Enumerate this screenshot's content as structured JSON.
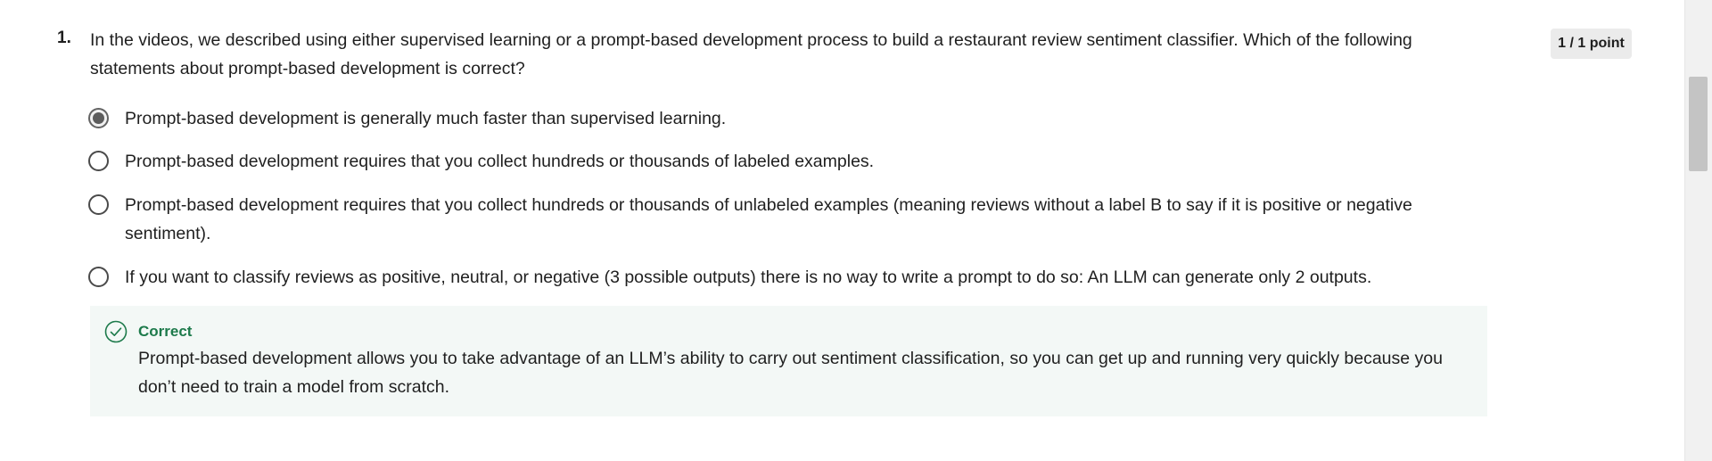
{
  "question": {
    "number": "1.",
    "text": "In the videos, we described using either supervised learning or a prompt-based development process to build a restaurant review sentiment classifier. Which of the following statements about prompt-based development is correct?",
    "score": "1 / 1 point"
  },
  "options": [
    {
      "label": "Prompt-based development is generally much faster than supervised learning.",
      "selected": true
    },
    {
      "label": "Prompt-based development requires that you collect hundreds or thousands of labeled examples.",
      "selected": false
    },
    {
      "label": "Prompt-based development requires that you collect hundreds or thousands of unlabeled examples (meaning reviews without a label B to say if it is positive or negative sentiment).",
      "selected": false
    },
    {
      "label": "If you want to classify reviews as positive, neutral, or negative (3 possible outputs) there is no way to write a prompt to do so: An LLM can generate only 2 outputs.",
      "selected": false
    }
  ],
  "feedback": {
    "icon": "check-circle-icon",
    "title": "Correct",
    "text": "Prompt-based development allows you to take advantage of an LLM’s ability to carry out sentiment classification, so you can get up and running very quickly because you don’t need to train a model from scratch."
  },
  "colors": {
    "correct": "#1d7a4b",
    "feedback_bg": "#f3f8f6",
    "badge_bg": "#ebebeb"
  }
}
